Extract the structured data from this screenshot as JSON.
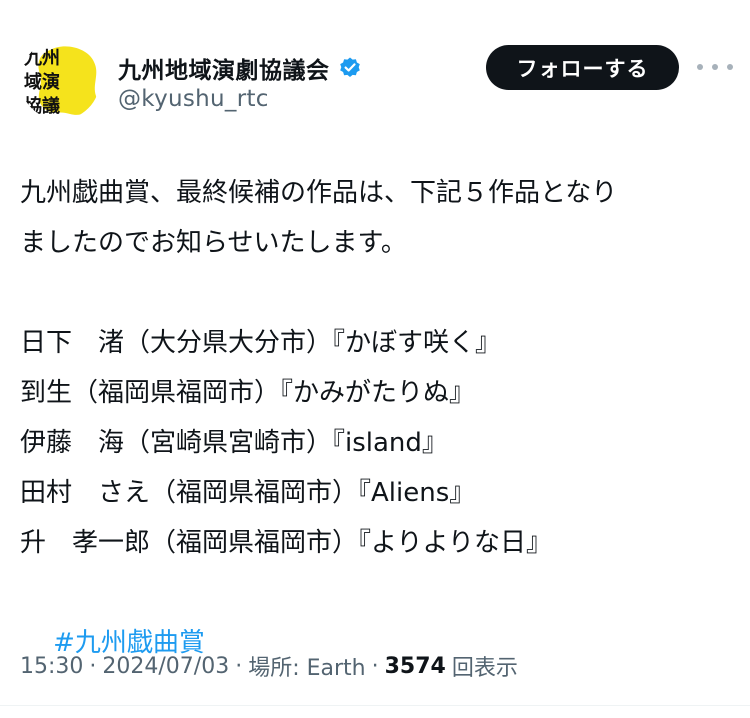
{
  "header": {
    "display_name": "九州地域演劇協議会",
    "handle": "@kyushu_rtc",
    "follow_label": "フォローする",
    "verified": true,
    "avatar_text": "九州地域演劇協議会"
  },
  "tweet": {
    "lines": [
      "九州戯曲賞、最終候補の作品は、下記５作品となり",
      "ましたのでお知らせいたします。",
      "",
      "日下　渚（大分県大分市）『かぼす咲く』",
      "到生（福岡県福岡市）『かみがたりぬ』",
      "伊藤　海（宮崎県宮崎市）『island』",
      "田村　さえ（福岡県福岡市）『Aliens』",
      "升　孝一郎（福岡県福岡市）『よりよりな日』"
    ],
    "hashtag": "#九州戯曲賞"
  },
  "meta": {
    "time": "15:30",
    "separator": "·",
    "date": "2024/07/03",
    "location": "場所: Earth",
    "views_count": "3574",
    "views_label": "回表示"
  },
  "colors": {
    "text": "#0f1419",
    "secondary": "#536471",
    "link": "#1d9bf0",
    "verified_badge": "#1d9bf0",
    "follow_button_bg": "#0f1419",
    "avatar_yellow": "#f5e31c"
  },
  "icons": {
    "verified": "verified-badge-icon",
    "more": "more-horizontal-icon"
  }
}
